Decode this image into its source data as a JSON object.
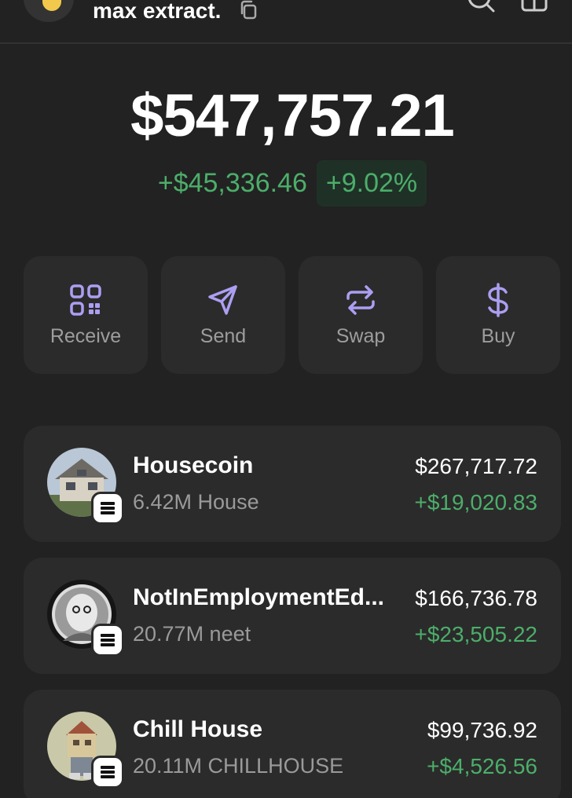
{
  "header": {
    "account_name": "max extract."
  },
  "balance": {
    "total": "$547,757.21",
    "change_amount": "+$45,336.46",
    "change_percent": "+9.02%"
  },
  "actions": [
    {
      "label": "Receive",
      "icon": "qr-code-icon"
    },
    {
      "label": "Send",
      "icon": "send-icon"
    },
    {
      "label": "Swap",
      "icon": "swap-icon"
    },
    {
      "label": "Buy",
      "icon": "dollar-icon"
    }
  ],
  "tokens": [
    {
      "name": "Housecoin",
      "quantity": "6.42M House",
      "value": "$267,717.72",
      "change": "+$19,020.83"
    },
    {
      "name": "NotInEmploymentEd...",
      "quantity": "20.77M neet",
      "value": "$166,736.78",
      "change": "+$23,505.22"
    },
    {
      "name": "Chill House",
      "quantity": "20.11M CHILLHOUSE",
      "value": "$99,736.92",
      "change": "+$4,526.56"
    }
  ],
  "colors": {
    "background": "#222222",
    "card": "#2b2b2b",
    "accent": "#ab9ff2",
    "positive": "#4cae6a"
  }
}
